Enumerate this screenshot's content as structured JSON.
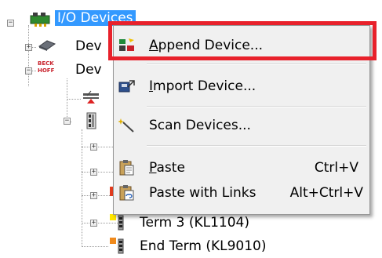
{
  "tree": {
    "root_label": "I/O Devices",
    "items": [
      {
        "label": "Dev"
      },
      {
        "label": "Dev"
      },
      {
        "label": "Term 3 (KL1104)"
      },
      {
        "label": "End Term (KL9010)"
      }
    ],
    "beckhoff_logo": [
      "BECK",
      "HOFF"
    ]
  },
  "context_menu": {
    "items": [
      {
        "label_underlined": "A",
        "label_rest": "ppend Device...",
        "shortcut": "",
        "icon": "append-device-icon"
      },
      {
        "label_underlined": "I",
        "label_rest": "mport Device...",
        "shortcut": "",
        "icon": "import-device-icon"
      },
      {
        "label_underlined": "",
        "label_rest": "Scan Devices...",
        "shortcut": "",
        "icon": "scan-wand-icon"
      },
      {
        "label_underlined": "P",
        "label_rest": "aste",
        "shortcut": "Ctrl+V",
        "icon": "paste-icon"
      },
      {
        "label_underlined": "",
        "label_rest": "Paste with Links",
        "shortcut": "Alt+Ctrl+V",
        "icon": "paste-links-icon"
      }
    ]
  },
  "colors": {
    "selection": "#3399ff",
    "highlight_border": "#e8212b",
    "menu_background": "#f0f0f0"
  }
}
